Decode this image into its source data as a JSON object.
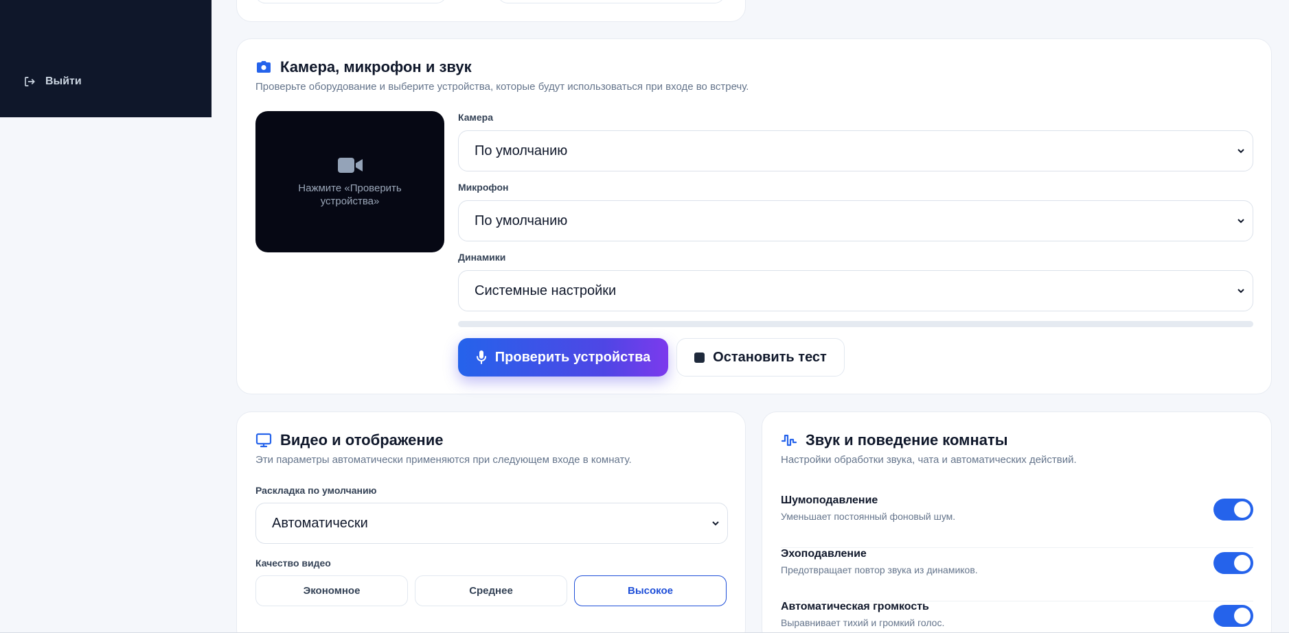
{
  "sidebar": {
    "logout_label": "Выйти"
  },
  "media": {
    "title": "Камера, микрофон и звук",
    "subtitle": "Проверьте оборудование и выберите устройства, которые будут использоваться при входе во встречу.",
    "preview_text": "Нажмите «Проверить устройства»",
    "camera_label": "Камера",
    "camera_value": "По умолчанию",
    "mic_label": "Микрофон",
    "mic_value": "По умолчанию",
    "speakers_label": "Динамики",
    "speakers_value": "Системные настройки",
    "mic_level": 0,
    "test_button": "Проверить устройства",
    "stop_button": "Остановить тест"
  },
  "video": {
    "title": "Видео и отображение",
    "subtitle": "Эти параметры автоматически применяются при следующем входе в комнату.",
    "layout_label": "Раскладка по умолчанию",
    "layout_value": "Автоматически",
    "quality_label": "Качество видео",
    "quality_options": [
      "Экономное",
      "Среднее",
      "Высокое"
    ],
    "quality_selected": "Высокое"
  },
  "sound": {
    "title": "Звук и поведение комнаты",
    "subtitle": "Настройки обработки звука, чата и автоматических действий.",
    "toggles": [
      {
        "title": "Шумоподавление",
        "desc": "Уменьшает постоянный фоновый шум.",
        "on": true
      },
      {
        "title": "Эхоподавление",
        "desc": "Предотвращает повтор звука из динамиков.",
        "on": true
      },
      {
        "title": "Автоматическая громкость",
        "desc": "Выравнивает тихий и громкий голос.",
        "on": true
      }
    ]
  },
  "colors": {
    "accent": "#2563eb",
    "sidebar": "#0f172a",
    "gradient_end": "#7c3aed"
  }
}
